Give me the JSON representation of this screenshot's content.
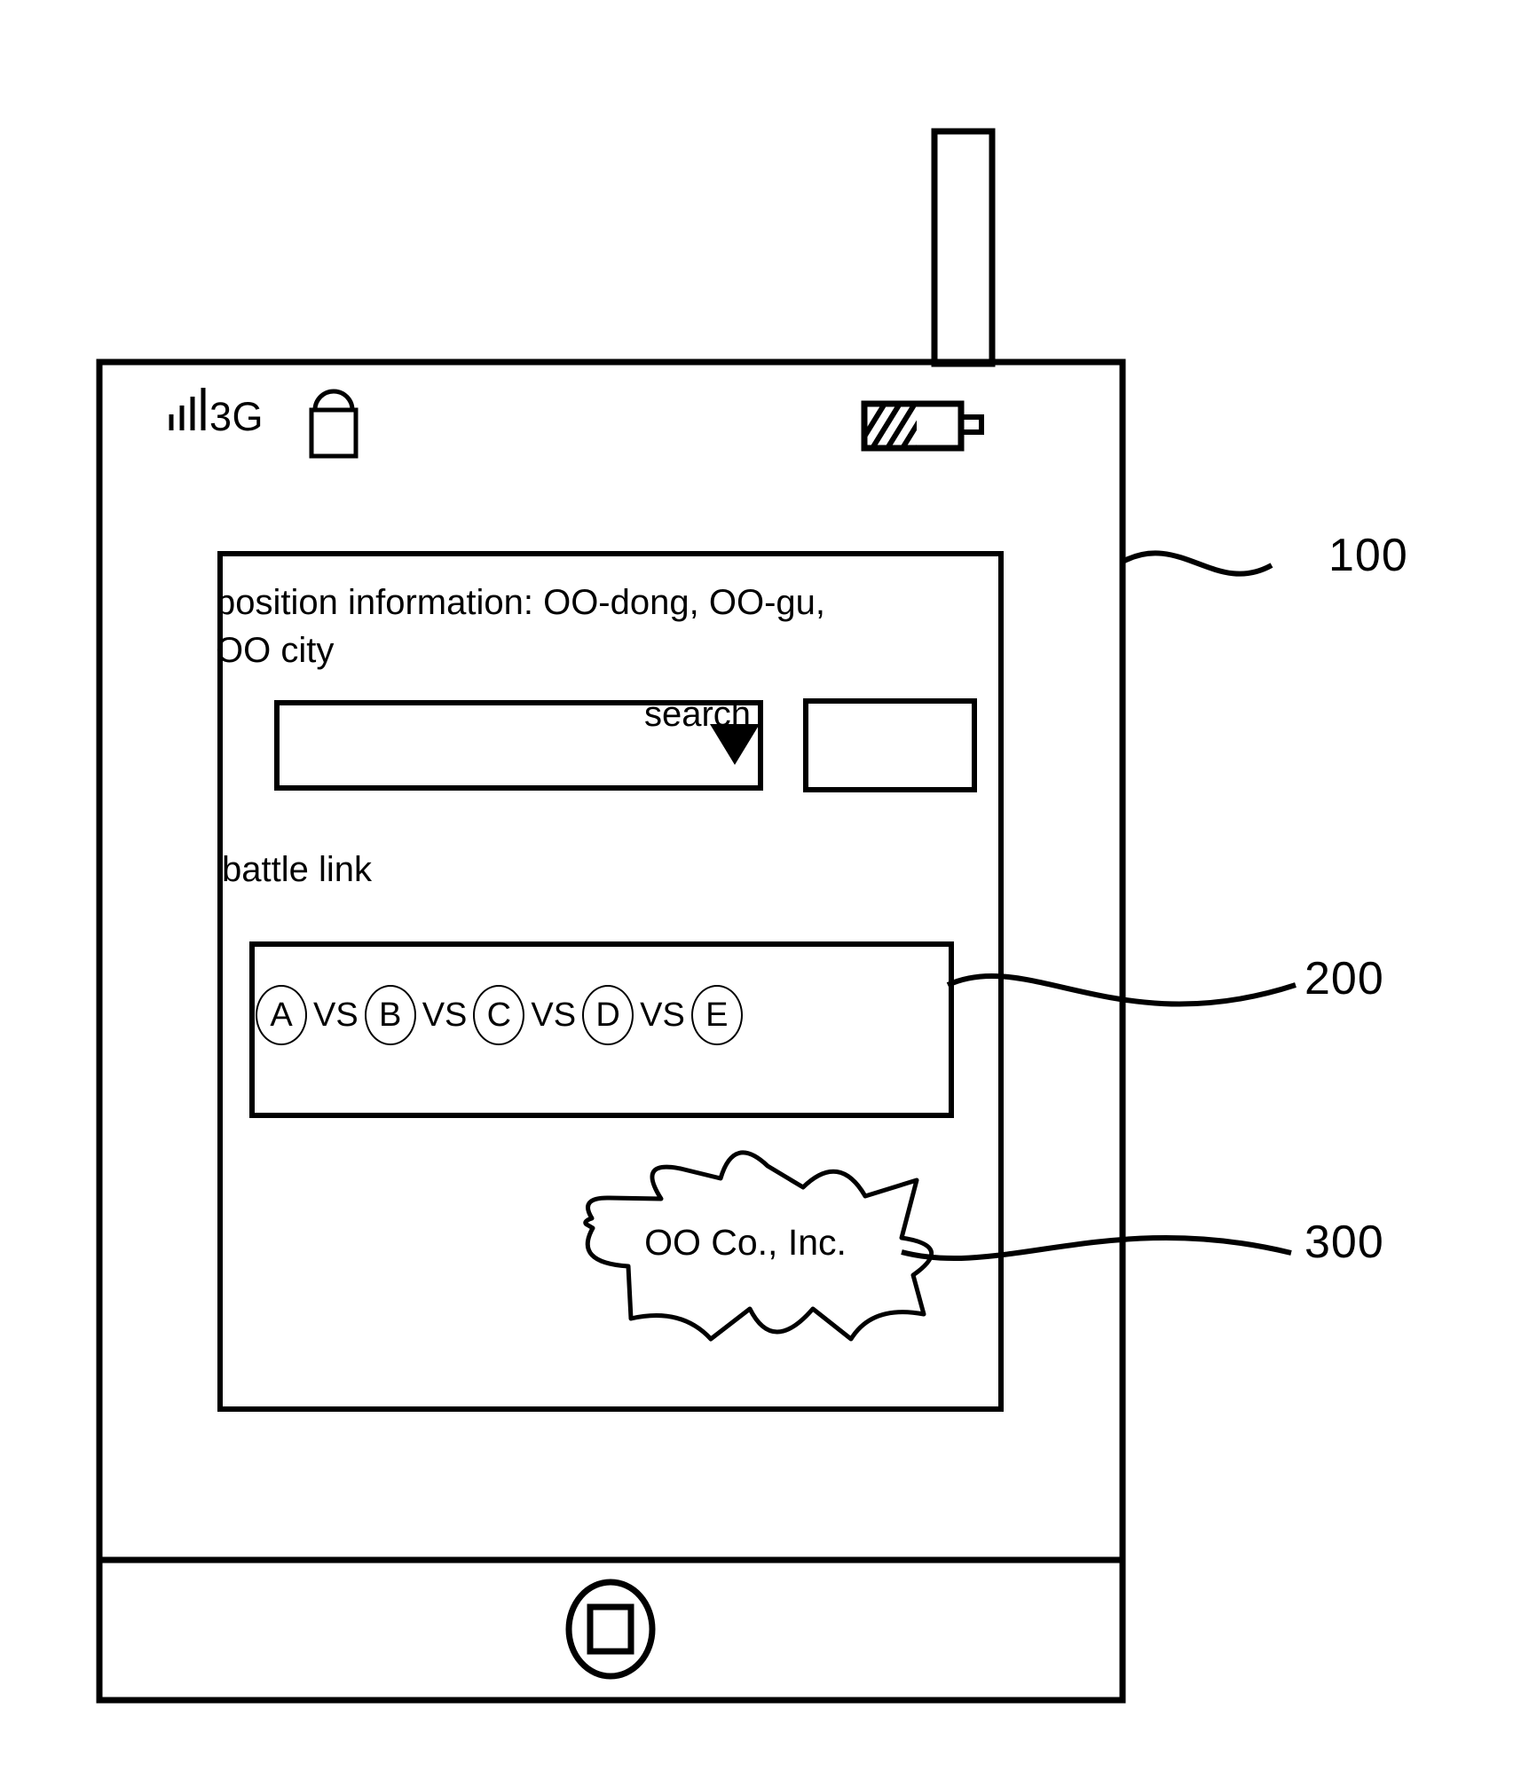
{
  "figure": {
    "type": "patent-drawing",
    "stroke_color": "#000000",
    "background_color": "#ffffff"
  },
  "device": {
    "name": "mobile-phone",
    "reference_numeral": "100",
    "antenna": "antenna-stub"
  },
  "status_bar": {
    "signal_icon": "signal-bars-icon",
    "network_label": "3G",
    "lock_icon": "lock-icon",
    "battery_icon": "battery-icon",
    "battery_fill_percent": 55
  },
  "screen": {
    "position_information": "position information: OO-dong, OO-gu, OO city",
    "dropdown": {
      "value": "",
      "placeholder": "",
      "arrow_icon": "chevron-down-icon"
    },
    "search_button": {
      "label": "search"
    },
    "battle_link": {
      "label": "battle link",
      "reference_numeral": "200",
      "matchup": [
        {
          "kind": "chip",
          "text": "A"
        },
        {
          "kind": "vs",
          "text": "VS"
        },
        {
          "kind": "chip",
          "text": "B"
        },
        {
          "kind": "vs",
          "text": "VS"
        },
        {
          "kind": "chip",
          "text": "C"
        },
        {
          "kind": "vs",
          "text": "VS"
        },
        {
          "kind": "chip",
          "text": "D"
        },
        {
          "kind": "vs",
          "text": "VS"
        },
        {
          "kind": "chip",
          "text": "E"
        }
      ]
    },
    "advertisement_burst": {
      "text": "OO Co., Inc.",
      "reference_numeral": "300"
    }
  },
  "home_button": {
    "name": "home-button",
    "glyph": "square-in-circle"
  },
  "reference_numerals": [
    {
      "id": "ref-100",
      "label": "100",
      "points_to": "mobile-phone-body"
    },
    {
      "id": "ref-200",
      "label": "200",
      "points_to": "battle-link-box"
    },
    {
      "id": "ref-300",
      "label": "300",
      "points_to": "advertisement-burst"
    }
  ]
}
